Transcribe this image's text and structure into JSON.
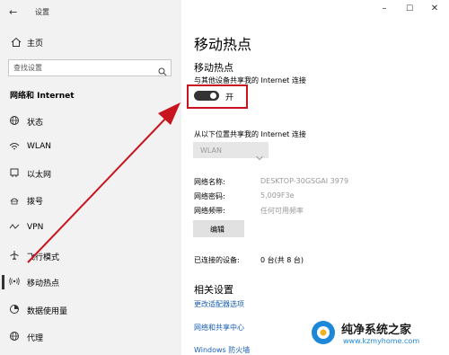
{
  "window": {
    "title": "设置",
    "controls": [
      "–",
      "☐",
      "✕"
    ]
  },
  "sidebar": {
    "home": "主页",
    "search_placeholder": "查找设置",
    "section": "网络和 Internet",
    "items": [
      {
        "label": "状态",
        "icon": "globe-icon"
      },
      {
        "label": "WLAN",
        "icon": "wifi-icon"
      },
      {
        "label": "以太网",
        "icon": "ethernet-icon"
      },
      {
        "label": "拨号",
        "icon": "dialup-icon"
      },
      {
        "label": "VPN",
        "icon": "vpn-icon"
      },
      {
        "label": "飞行模式",
        "icon": "airplane-icon"
      },
      {
        "label": "移动热点",
        "icon": "hotspot-icon",
        "active": true
      },
      {
        "label": "数据使用量",
        "icon": "data-usage-icon"
      },
      {
        "label": "代理",
        "icon": "globe-icon"
      }
    ]
  },
  "main": {
    "page_title": "移动热点",
    "section_title": "移动热点",
    "share_desc": "与其他设备共享我的 Internet 连接",
    "toggle": {
      "state": "开",
      "on": true
    },
    "share_from_label": "从以下位置共享我的 Internet 连接",
    "share_from_value": "WLAN",
    "network_name_label": "网络名称:",
    "network_name_value": "DESKTOP-30GSGAI 3979",
    "password_label": "网络密码:",
    "password_value": "5,009F3e",
    "band_label": "网络频带:",
    "band_value": "任何可用频率",
    "edit_button": "编辑",
    "connected_label": "已连接的设备:",
    "connected_value": "0 台(共 8 台)",
    "related_title": "相关设置",
    "links": [
      "更改适配器选项",
      "网络和共享中心",
      "Windows 防火墙"
    ]
  },
  "watermark": {
    "text": "纯净系统之家",
    "url": "www.kzmyhome.com"
  },
  "colors": {
    "annotation_red": "#c8141e",
    "toggle_dark": "#333333",
    "link_blue": "#1a5fb4"
  }
}
